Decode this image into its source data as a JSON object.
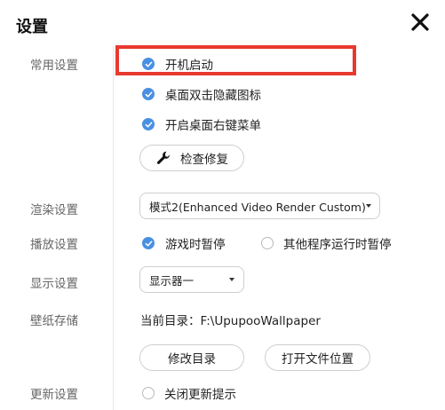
{
  "window": {
    "title": "设置",
    "close_icon": "close-x-icon"
  },
  "sections": {
    "common": "常用设置",
    "render": "渲染设置",
    "playback": "播放设置",
    "display": "显示设置",
    "storage": "壁纸存储",
    "update": "更新设置"
  },
  "common": {
    "autostart": {
      "label": "开机启动",
      "checked": true
    },
    "doubleclick_hide": {
      "label": "桌面双击隐藏图标",
      "checked": true
    },
    "context_menu": {
      "label": "开启桌面右键菜单",
      "checked": true
    },
    "repair_button": {
      "label": "检查修复",
      "icon": "wrench-icon"
    }
  },
  "render": {
    "selected": "模式2(Enhanced Video Render Custom)"
  },
  "playback": {
    "game_pause": {
      "label": "游戏时暂停",
      "checked": true
    },
    "other_pause": {
      "label": "其他程序运行时暂停",
      "checked": false
    }
  },
  "display": {
    "selected": "显示器一"
  },
  "storage": {
    "current_dir_label": "当前目录：",
    "current_dir_value": "F:\\UpupooWallpaper",
    "change_dir_button": "修改目录",
    "open_location_button": "打开文件位置"
  },
  "update": {
    "close_tips": {
      "label": "关闭更新提示",
      "checked": false
    }
  },
  "colors": {
    "accent": "#4a90e2",
    "highlight": "#e8392f",
    "label": "#666666"
  }
}
